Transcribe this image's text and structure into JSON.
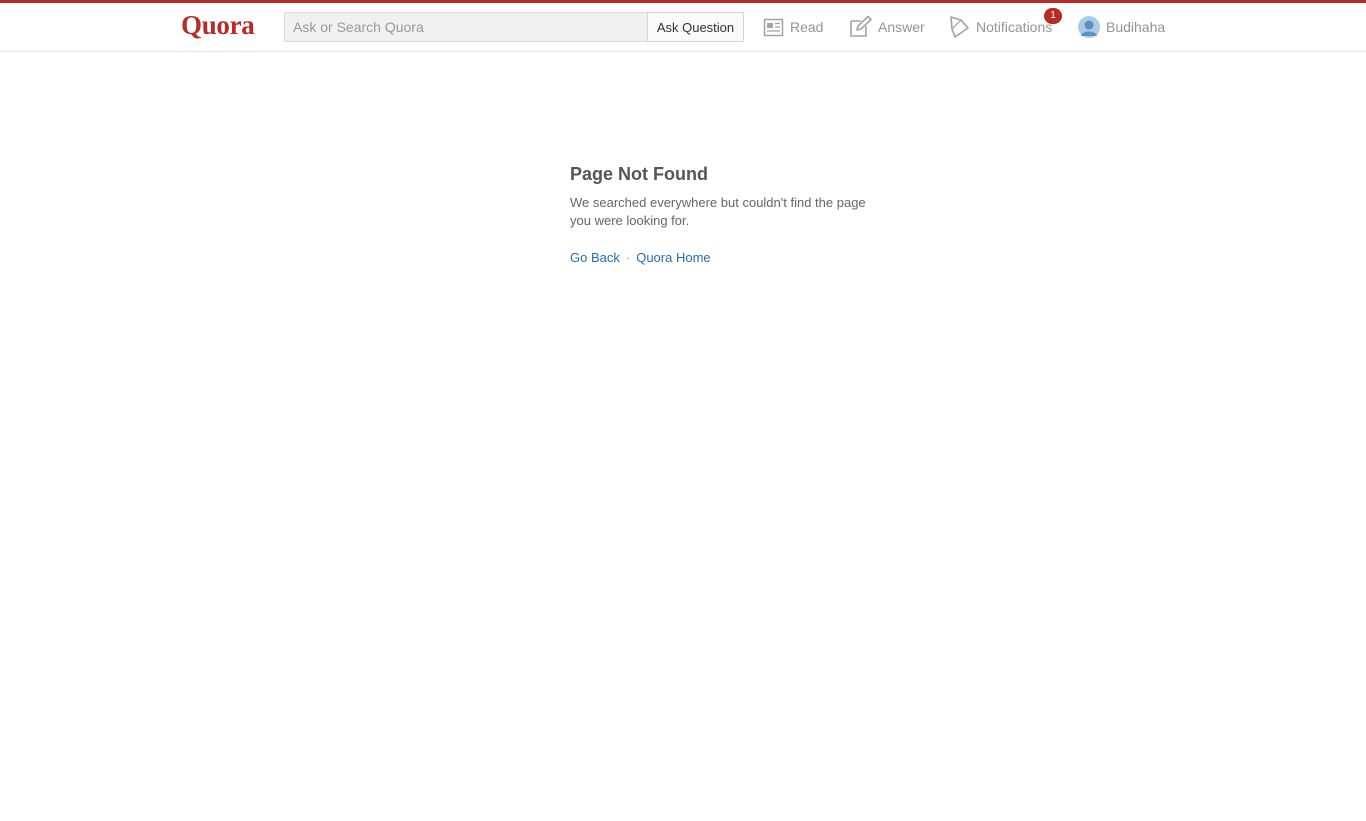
{
  "header": {
    "logo": "Quora",
    "search": {
      "placeholder": "Ask or Search Quora",
      "value": ""
    },
    "ask_button": "Ask Question",
    "nav": {
      "read": "Read",
      "answer": "Answer",
      "notifications": "Notifications",
      "notifications_count": "1",
      "profile": "Budihaha"
    }
  },
  "main": {
    "title": "Page Not Found",
    "description": "We searched everywhere but couldn't find the page you were looking for.",
    "links": {
      "go_back": "Go Back",
      "separator": "·",
      "home": "Quora Home"
    }
  },
  "colors": {
    "brand": "#b92b27",
    "link": "#2b6dad",
    "nav_text": "#949494"
  },
  "icons": [
    "news-feed-icon",
    "pencil-icon",
    "bell-icon",
    "user-avatar"
  ]
}
